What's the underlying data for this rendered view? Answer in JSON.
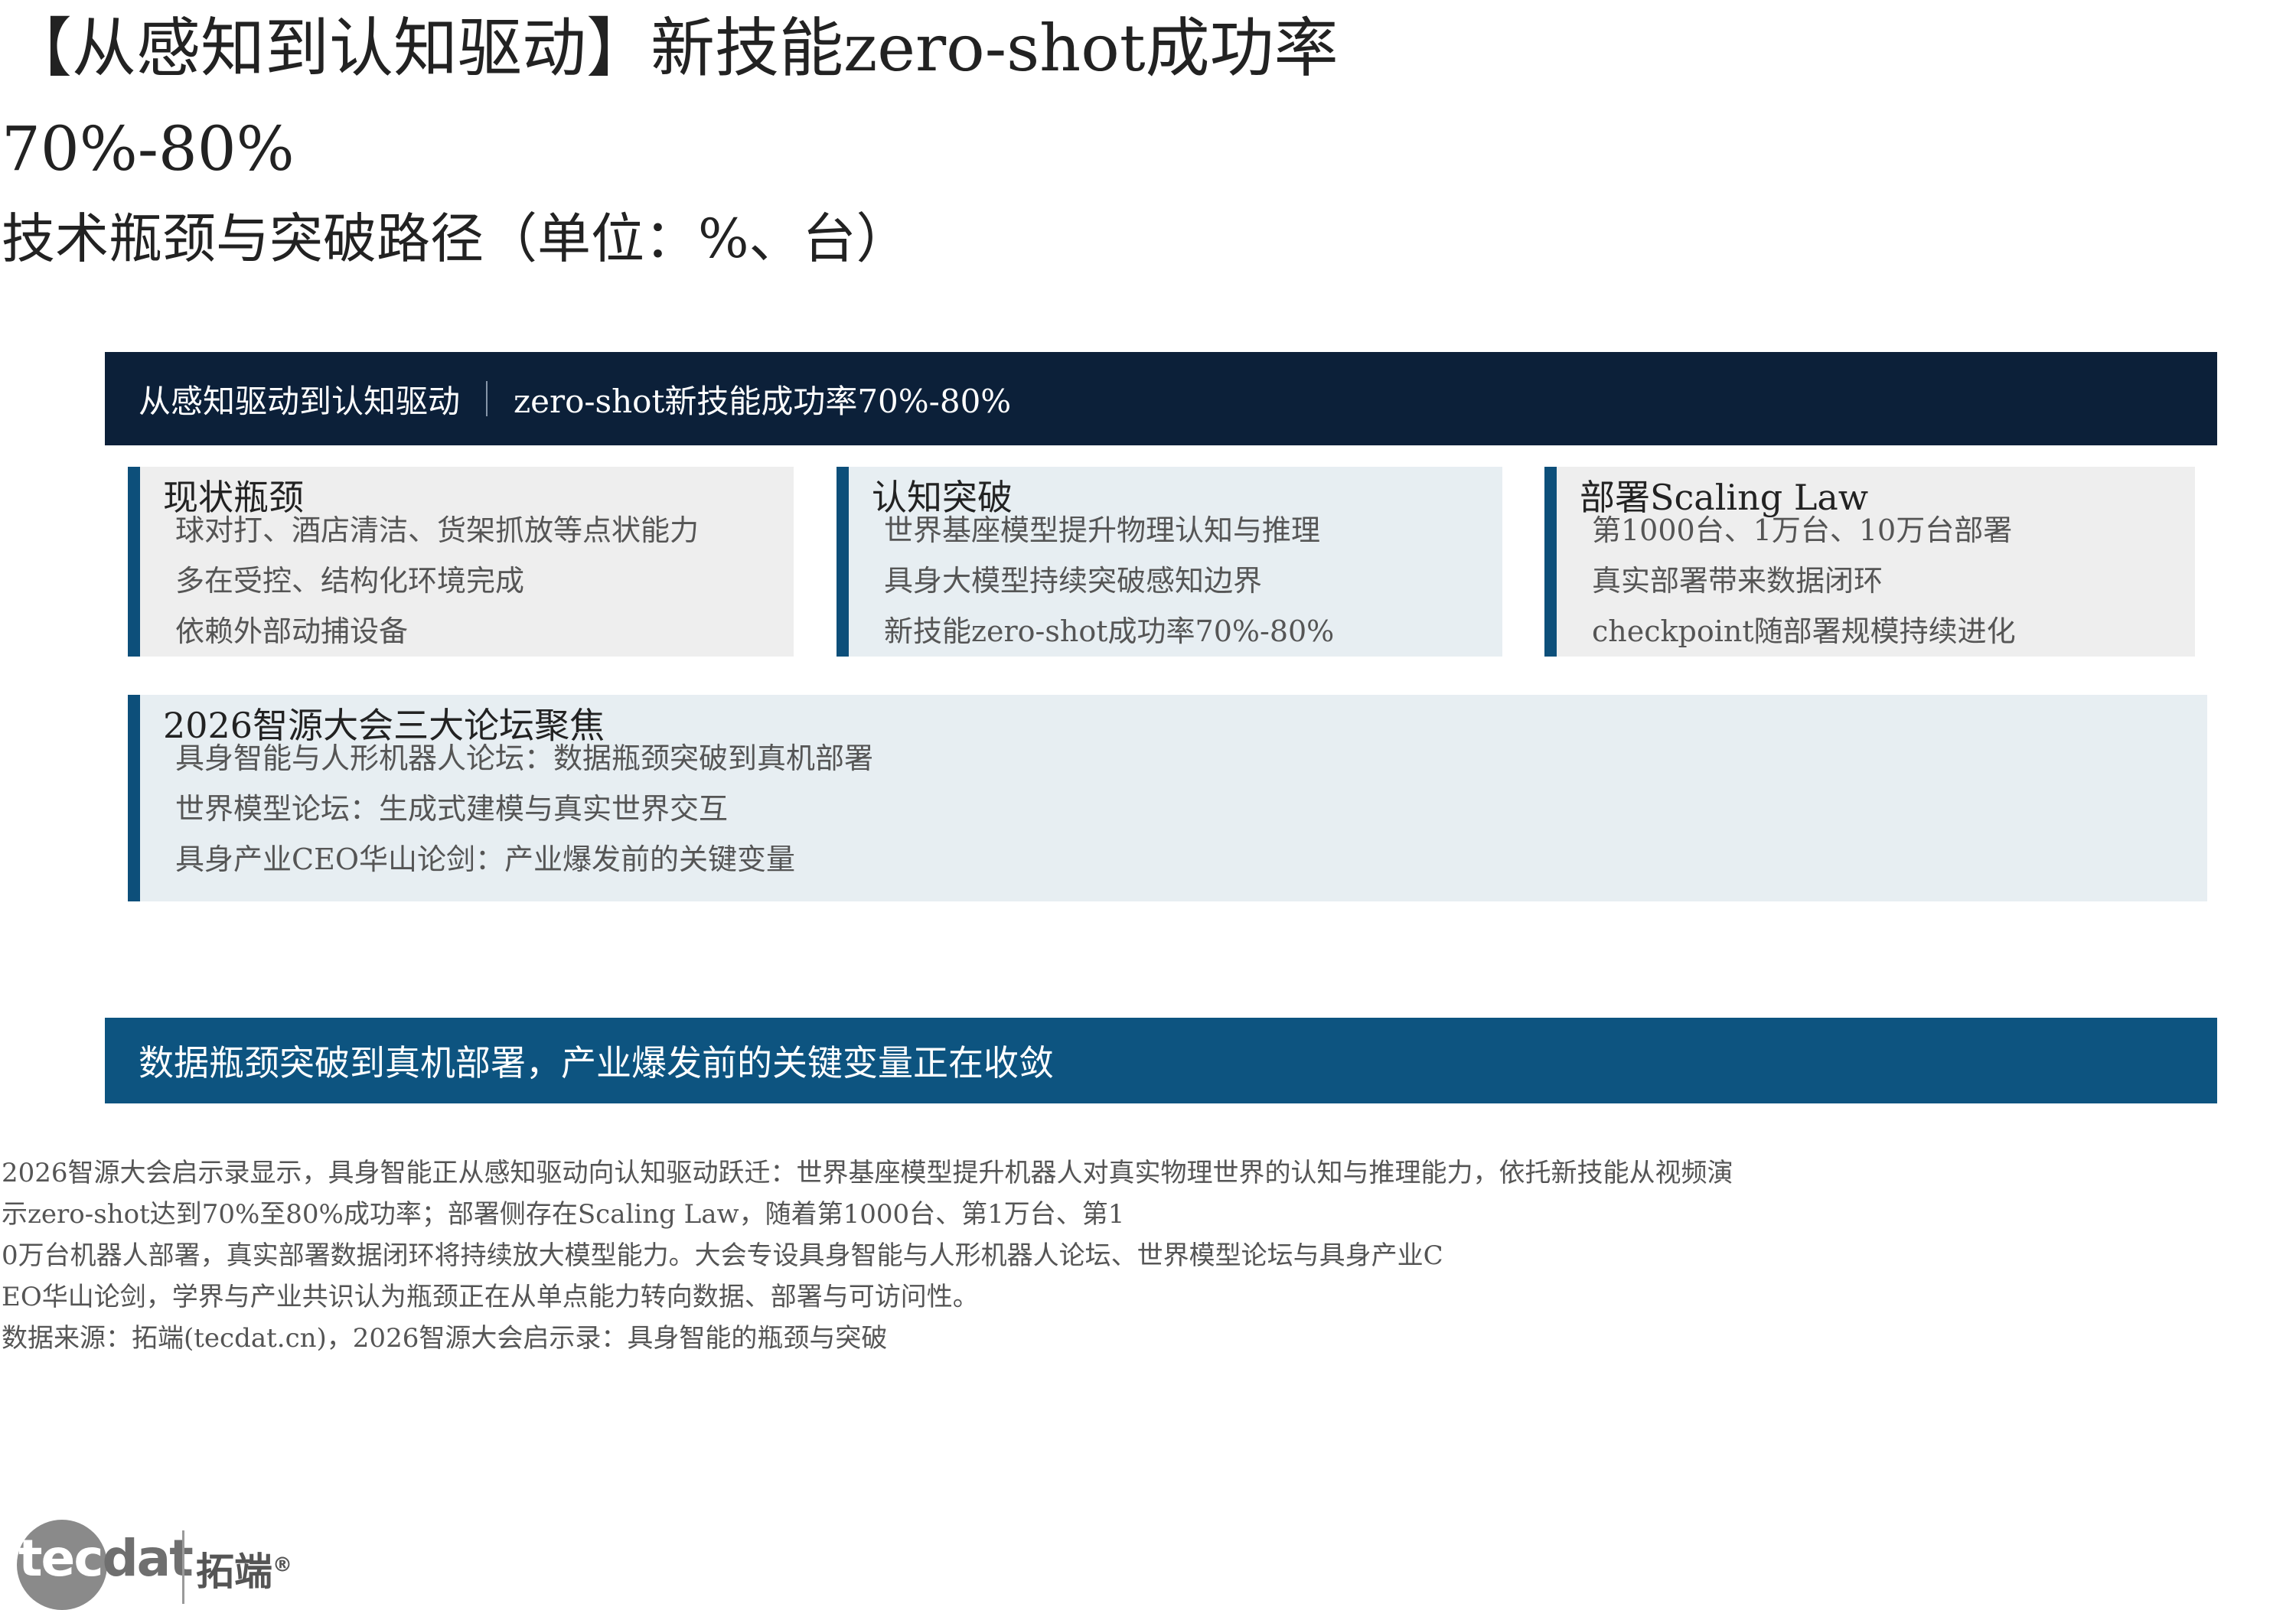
{
  "header": {
    "title": "【从感知到认知驱动】新技能zero-shot成功率",
    "rate": "70%-80%",
    "chart_title": "技术瓶颈与突破路径（单位：%、台）"
  },
  "banner": {
    "left": "从感知驱动到认知驱动",
    "right": "zero-shot新技能成功率70%-80%"
  },
  "cards": [
    {
      "title": "现状瓶颈",
      "items": [
        "球对打、酒店清洁、货架抓放等点状能力",
        "多在受控、结构化环境完成",
        "依赖外部动捕设备"
      ]
    },
    {
      "title": "认知突破",
      "items": [
        "世界基座模型提升物理认知与推理",
        "具身大模型持续突破感知边界",
        "新技能zero-shot成功率70%-80%"
      ]
    },
    {
      "title": "部署Scaling Law",
      "items": [
        "第1000台、1万台、10万台部署",
        "真实部署带来数据闭环",
        "checkpoint随部署规模持续进化"
      ]
    }
  ],
  "focus": {
    "title": "2026智源大会三大论坛聚焦",
    "items": [
      "具身智能与人形机器人论坛：数据瓶颈突破到真机部署",
      "世界模型论坛：生成式建模与真实世界交互",
      "具身产业CEO华山论剑：产业爆发前的关键变量"
    ]
  },
  "conclusion": "数据瓶颈突破到真机部署，产业爆发前的关键变量正在收敛",
  "body": [
    "2026智源大会启示录显示，具身智能正从感知驱动向认知驱动跃迁：世界基座模型提升机器人对真实物理世界的认知与推理能力，依托新技能从视频演",
    "示zero-shot达到70%至80%成功率；部署侧存在Scaling Law，随着第1000台、第1万台、第1",
    "0万台机器人部署，真实部署数据闭环将持续放大模型能力。大会专设具身智能与人形机器人论坛、世界模型论坛与具身产业C",
    "EO华山论剑，学界与产业共识认为瓶颈正在从单点能力转向数据、部署与可访问性。"
  ],
  "source": "数据来源：拓端(tecdat.cn)，2026智源大会启示录：具身智能的瓶颈与突破",
  "logo": {
    "brand_left": "tec",
    "brand_right": "dat",
    "cn": "拓端",
    "mark": "®"
  },
  "colors": {
    "banner_dark": "#0c2039",
    "accent_blue": "#0d4f7a",
    "conclusion_blue": "#0d5480",
    "card_gray": "#eeeeee",
    "card_blue": "#e7eef2"
  }
}
